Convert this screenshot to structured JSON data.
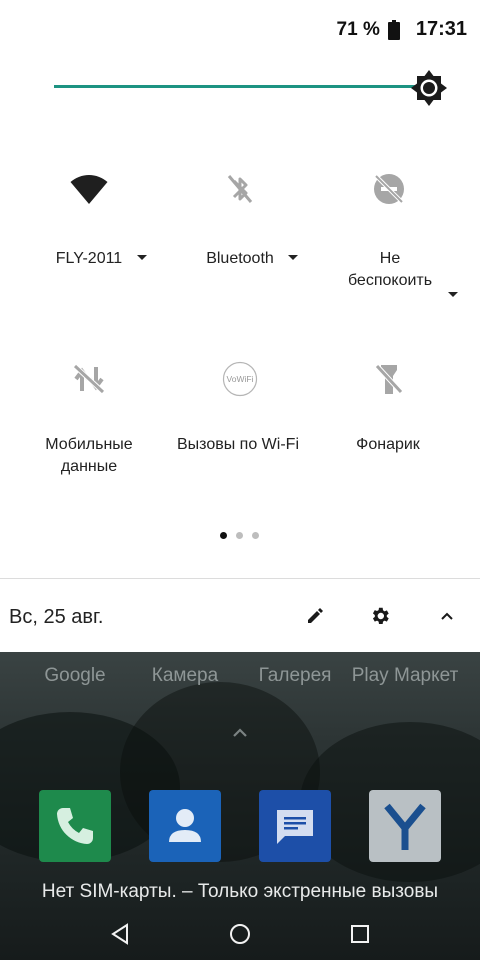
{
  "status_bar": {
    "battery_percent": "71 %",
    "time": "17:31"
  },
  "brightness": {
    "level": 0.93
  },
  "tiles": [
    {
      "label": "FLY-2011",
      "icon": "wifi-icon",
      "has_dropdown": true,
      "active": true
    },
    {
      "label": "Bluetooth",
      "icon": "bluetooth-off-icon",
      "has_dropdown": true,
      "active": false
    },
    {
      "label": "Не беспокоить",
      "icon": "do-not-disturb-off-icon",
      "has_dropdown": true,
      "active": false
    },
    {
      "label": "Мобильные данные",
      "icon": "mobile-data-off-icon",
      "has_dropdown": false,
      "active": false
    },
    {
      "label": "Вызовы по Wi-Fi",
      "icon": "vowifi-icon",
      "icon_text": "VoWiFi",
      "has_dropdown": false,
      "active": false
    },
    {
      "label": "Фонарик",
      "icon": "flashlight-off-icon",
      "has_dropdown": false,
      "active": false
    }
  ],
  "pages": {
    "count": 3,
    "current": 1
  },
  "date_row": {
    "date": "Вс, 25 авг.",
    "icons": [
      "edit-icon",
      "settings-icon",
      "collapse-icon"
    ]
  },
  "home_apps": [
    {
      "label": "Google"
    },
    {
      "label": "Камера"
    },
    {
      "label": "Галерея"
    },
    {
      "label": "Play Маркет"
    }
  ],
  "dock": [
    {
      "name": "phone-app",
      "color": "#1e8a4c"
    },
    {
      "name": "contacts-app",
      "color": "#1b63b8"
    },
    {
      "name": "messages-app",
      "color": "#1d4fa8"
    },
    {
      "name": "yandex-app",
      "color": "#b9c0c4"
    }
  ],
  "lock_message": "Нет SIM-карты. – Только экстренные вызовы",
  "colors": {
    "accent": "#1d9382",
    "icon_active": "#222222",
    "icon_inactive": "#a6a6a6"
  }
}
